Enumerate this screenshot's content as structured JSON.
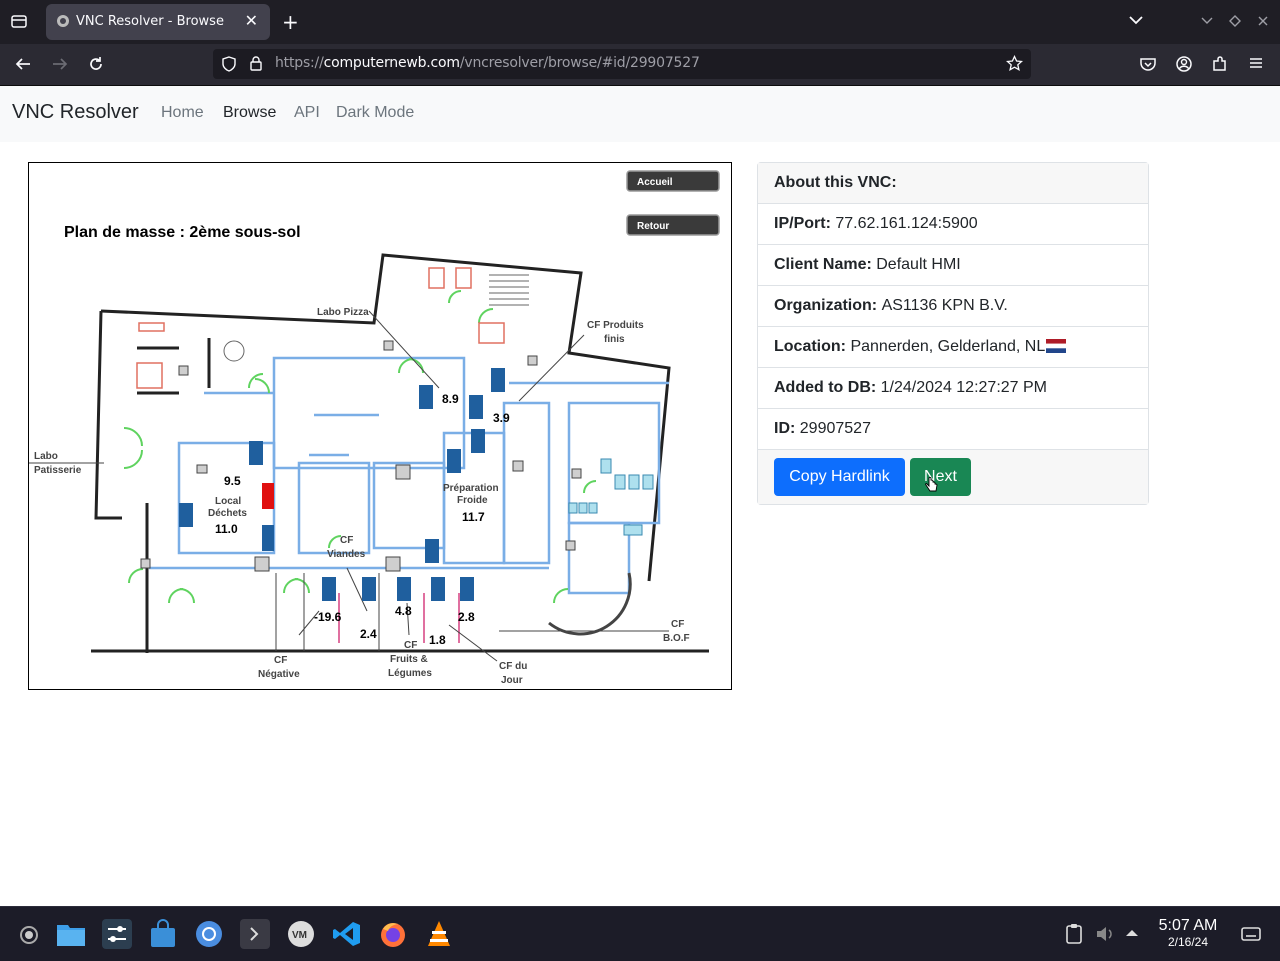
{
  "browser": {
    "tab_title": "VNC Resolver - Browse",
    "url_prefix": "https://",
    "url_host": "computernewb.com",
    "url_path": "/vncresolver/browse/#id/29907527"
  },
  "site": {
    "brand": "VNC Resolver",
    "nav": [
      "Home",
      "Browse",
      "API",
      "Dark Mode"
    ],
    "active_nav": "Browse"
  },
  "screenshot": {
    "title": "Plan de masse : 2ème sous-sol",
    "buttons": [
      "Accueil",
      "Retour"
    ],
    "room_labels": {
      "labo_pizza": "Labo Pizza",
      "cf_produits": "CF Produits",
      "finis": "finis",
      "labo": "Labo",
      "patisserie": "Patisserie",
      "local": "Local",
      "dechets": "Déchets",
      "preparation": "Préparation",
      "froide": "Froide",
      "cf_viandes": "CF",
      "viandes": "Viandes",
      "cf_negative": "CF",
      "negative": "Négative",
      "cf_fruits": "CF",
      "fruits": "Fruits &",
      "legumes": "Légumes",
      "cf_jour": "CF du",
      "jour": "Jour",
      "cf_bof": "CF",
      "bof": "B.O.F"
    },
    "temperatures": {
      "labo_pizza": "8.9",
      "cf_produits": "3.9",
      "labo_patisserie": "9.5",
      "local_dechets": "11.0",
      "preparation": "11.7",
      "negative": "-19.6",
      "viandes": "2.4",
      "fruits": "4.8",
      "jour_a": "1.8",
      "jour_b": "2.8"
    }
  },
  "about": {
    "heading": "About this VNC:",
    "fields": [
      {
        "label": "IP/Port:",
        "value": "77.62.161.124:5900"
      },
      {
        "label": "Client Name:",
        "value": "Default HMI"
      },
      {
        "label": "Organization:",
        "value": "AS1136 KPN B.V."
      },
      {
        "label": "Location:",
        "value": "Pannerden, Gelderland, NL"
      },
      {
        "label": "Added to DB:",
        "value": "1/24/2024 12:27:27 PM"
      },
      {
        "label": "ID:",
        "value": "29907527"
      }
    ],
    "copy_button": "Copy Hardlink",
    "next_button": "Next"
  },
  "taskbar": {
    "time": "5:07 AM",
    "date": "2/16/24"
  },
  "colors": {
    "primary": "#0d6efd",
    "success": "#198754",
    "door_blue": "#1f5f9e",
    "door_alarm": "#e01010",
    "pipe_blue": "#7aaee6",
    "pipe_green": "#5fd35f"
  }
}
